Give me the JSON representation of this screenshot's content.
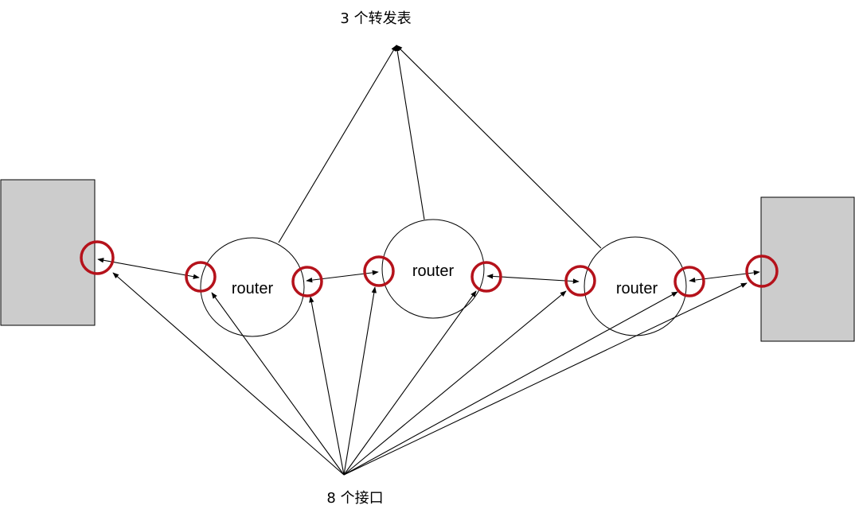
{
  "labels": {
    "forwarding_tables": "3 个转发表",
    "interfaces": "8 个接口"
  },
  "routers": [
    {
      "label": "router"
    },
    {
      "label": "router"
    },
    {
      "label": "router"
    }
  ],
  "colors": {
    "host_fill": "#cccccc",
    "interface_ring": "#b5121b",
    "line": "#000000"
  }
}
